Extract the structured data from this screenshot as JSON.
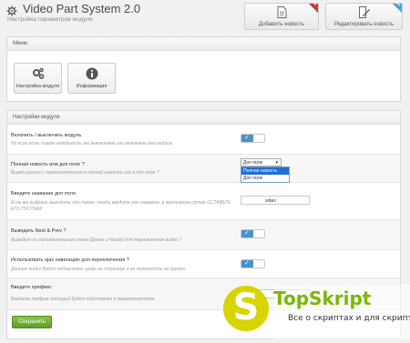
{
  "header": {
    "title": "Video Part System 2.0",
    "subtitle": "Настройка параметров модуля",
    "add_button_label": "Добавить новость",
    "edit_button_label": "Редактировать новость"
  },
  "menu_panel": {
    "title": "Меню",
    "items": [
      {
        "label": "Настройка модуля",
        "icon": "gears-icon"
      },
      {
        "label": "Информация",
        "icon": "info-icon"
      }
    ]
  },
  "settings_panel": {
    "title": "Настройки модуля",
    "rows": [
      {
        "title": "Включить / выключить модуль",
        "description": "Ну если есть такая надобность то выключаем или включаем наш модуль",
        "control": "toggle",
        "enabled": true
      },
      {
        "title": "Полная новость или доп поле ?",
        "description": "Вывод ролика с переключателем в полной новости или в доп поле ?",
        "control": "select",
        "selected": "Доп поле",
        "options": [
          "Полная новость",
          "Доп поле"
        ],
        "highlighted_option": "Полная новость"
      },
      {
        "title": "Введите название доп поля",
        "description": "Если вы выбрали выводить доп полем, тогда введите его название, в противном случае ОСТАВЬТЕ ЕГО ПУСТЫМ!",
        "control": "input",
        "value": "video"
      },
      {
        "title": "Выводить Next & Prev ?",
        "description": "Выводит ли дополнительные тега (Далее и Назад) для переключения видео ?",
        "control": "toggle",
        "enabled": true
      },
      {
        "title": "Использовать ajax навигацию для переключения ?",
        "description": "Данные видео будут подгружать сразу на странице а не переходить на другую",
        "control": "toggle",
        "enabled": true
      },
      {
        "title": "Введите префикс",
        "description": "Введите префикс который будет подставлен к переключателям",
        "control": "input",
        "value": ""
      }
    ]
  },
  "save_button_label": "Сохранить",
  "watermark": {
    "logo_letter": "S",
    "brand": "TopSkript",
    "tagline": "Все о скриптах и для скриптов..."
  },
  "colors": {
    "toggle_on": "#4b91c9",
    "save_button": "#6aa832",
    "corner_add": "#c0392b",
    "corner_edit": "#4a9fd8",
    "watermark_circle": "#d8d400",
    "watermark_brand": "#7ab800"
  }
}
